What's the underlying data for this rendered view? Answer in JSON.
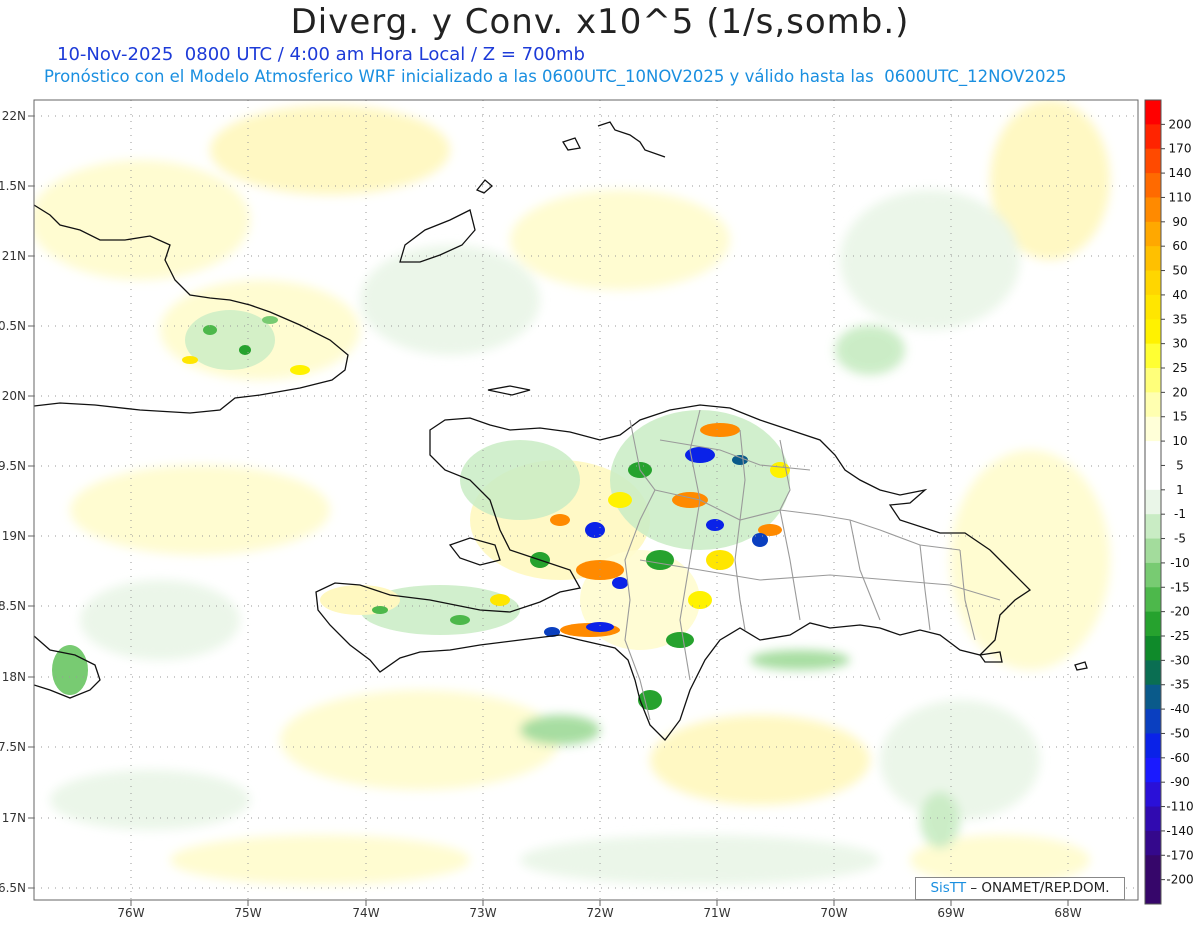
{
  "header": {
    "title": "Diverg. y Conv. x10^5 (1/s,somb.)",
    "subtitle": "10-Nov-2025  0800 UTC / 4:00 am Hora Local / Z = 700mb",
    "description": "Pronóstico con el Modelo Atmosferico WRF inicializado a las 0600UTC_10NOV2025 y válido hasta las  0600UTC_12NOV2025"
  },
  "axes": {
    "lat_labels": [
      "22N",
      "1.5N",
      "21N",
      "0.5N",
      "20N",
      "9.5N",
      "19N",
      "8.5N",
      "18N",
      "7.5N",
      "17N",
      "6.5N"
    ],
    "lon_labels": [
      "76W",
      "75W",
      "74W",
      "73W",
      "72W",
      "71W",
      "70W",
      "69W",
      "68W"
    ],
    "grid": "dotted"
  },
  "colorbar": {
    "levels": [
      "200",
      "170",
      "140",
      "110",
      "90",
      "60",
      "50",
      "40",
      "35",
      "30",
      "25",
      "20",
      "15",
      "10",
      "5",
      "1",
      "-1",
      "-5",
      "-10",
      "-15",
      "-20",
      "-25",
      "-30",
      "-35",
      "-40",
      "-50",
      "-60",
      "-90",
      "-110",
      "-140",
      "-170",
      "-200"
    ],
    "colors": [
      "#ff0000",
      "#ff2400",
      "#ff4a00",
      "#ff6a00",
      "#ff8a00",
      "#ffa800",
      "#ffc000",
      "#ffd600",
      "#ffe600",
      "#fff200",
      "#ffff33",
      "#ffff7a",
      "#ffffb0",
      "#ffffd8",
      "#ffffff",
      "#ffffff",
      "#eaf6e8",
      "#c9ecc4",
      "#a3dc9c",
      "#78cb72",
      "#4db84b",
      "#26a22e",
      "#0f8a2a",
      "#0a6e52",
      "#0a5a8a",
      "#0a3fc0",
      "#0a22e8",
      "#1a1aff",
      "#2a10d8",
      "#300ab0",
      "#34088c",
      "#36066a"
    ]
  },
  "credit": {
    "brand": "SisTT",
    "text": " – ONAMET/REP.DOM."
  }
}
